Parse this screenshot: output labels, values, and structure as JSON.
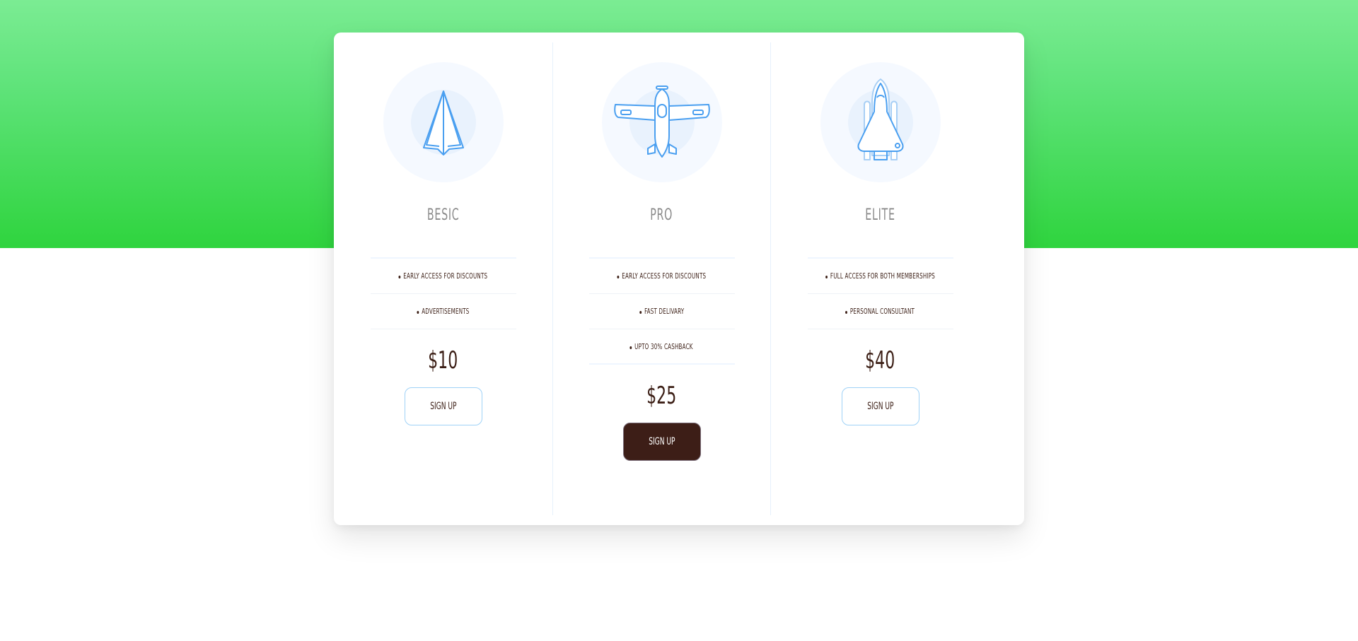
{
  "plans": [
    {
      "name": "BESIC",
      "icon": "paper-plane-icon",
      "features": [
        "EARLY ACCESS FOR DISCOUNTS",
        "ADVERTISEMENTS"
      ],
      "price": "$10",
      "button": "SIGN UP"
    },
    {
      "name": "PRO",
      "icon": "airplane-icon",
      "features": [
        "EARLY ACCESS FOR DISCOUNTS",
        "FAST DELIVARY",
        "UPTO 30% CASHBACK"
      ],
      "price": "$25",
      "button": "SIGN UP"
    },
    {
      "name": "ELITE",
      "icon": "space-shuttle-icon",
      "features": [
        "FULL ACCESS FOR BOTH MEMBERSHIPS",
        "PERSONAL CONSULTANT"
      ],
      "price": "$40",
      "button": "SIGN UP"
    }
  ],
  "colors": {
    "hero_top": "#7bec93",
    "hero_bottom": "#2fd43e",
    "icon_stroke": "#4a9ff0",
    "text_dark": "#3b1e15",
    "primary_button": "#3d1e17"
  }
}
